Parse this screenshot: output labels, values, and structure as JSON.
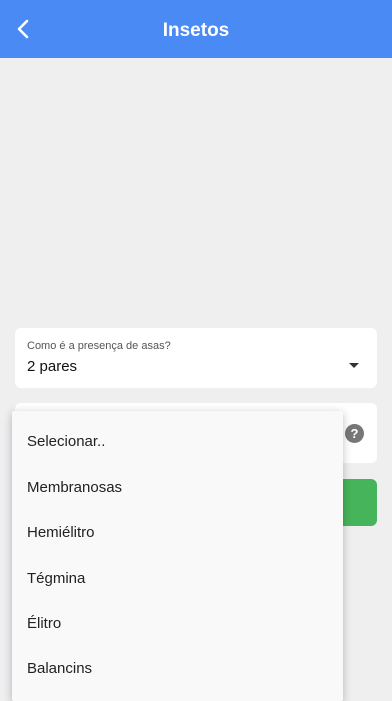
{
  "header": {
    "title": "Insetos",
    "back_icon": "chevron-left-icon"
  },
  "colors": {
    "appbar": "#4a8af4",
    "background": "#efeff0",
    "action_button": "#46b45a"
  },
  "question1": {
    "label": "Como é a presença de asas?",
    "value": "2 pares"
  },
  "help_icon_glyph": "?",
  "dropdown": {
    "options": [
      "Selecionar..",
      "Membranosas",
      "Hemiélitro",
      "Tégmina",
      "Élitro",
      "Balancins"
    ]
  }
}
